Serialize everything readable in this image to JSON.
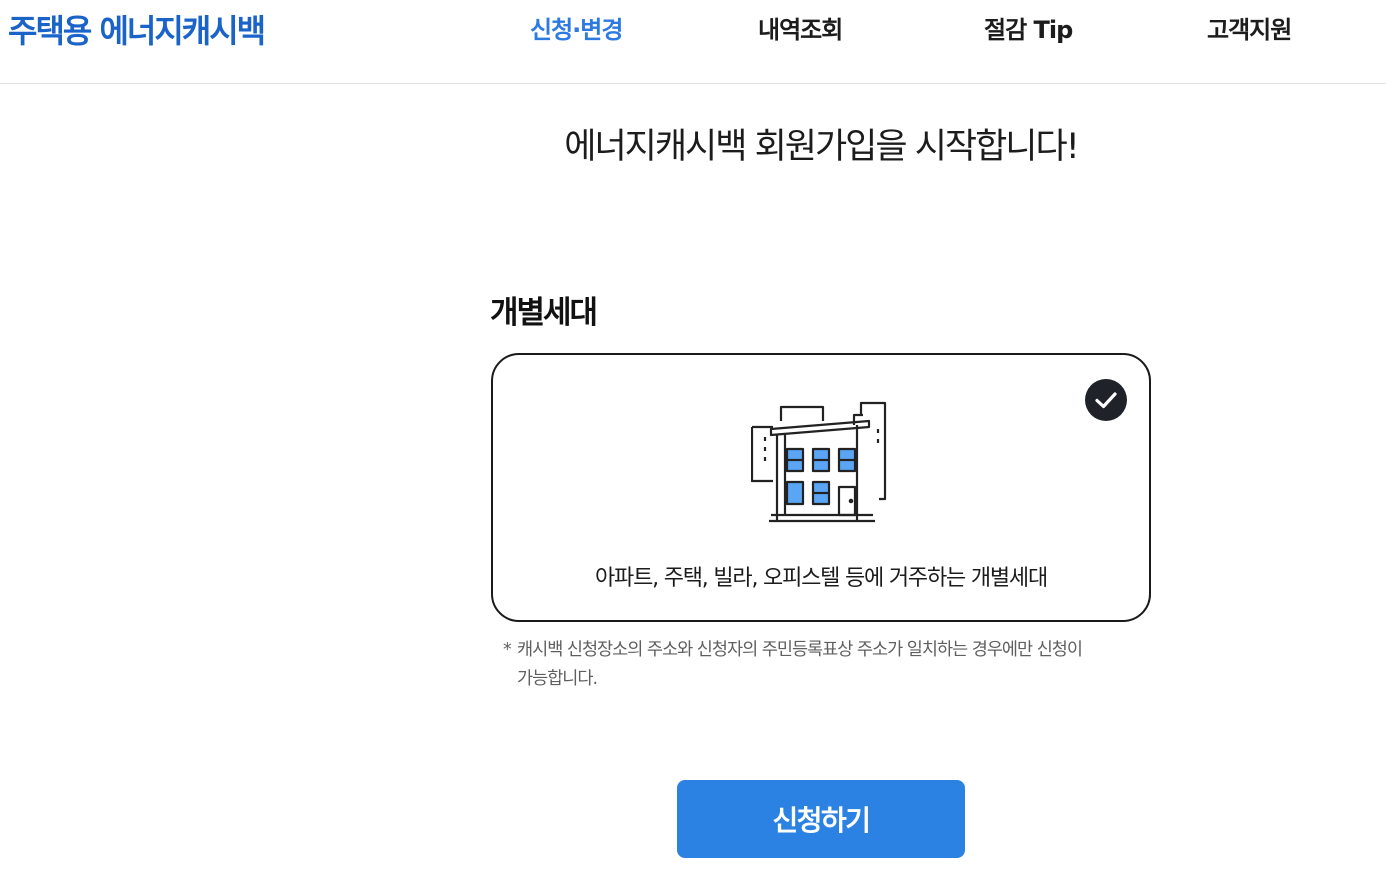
{
  "header": {
    "logo": "주택용 에너지캐시백",
    "nav": [
      {
        "label": "신청·변경",
        "active": true
      },
      {
        "label": "내역조회",
        "active": false
      },
      {
        "label": "절감 Tip",
        "active": false
      },
      {
        "label": "고객지원",
        "active": false
      }
    ]
  },
  "main": {
    "title": "에너지캐시백 회원가입을 시작합니다!",
    "section_title": "개별세대",
    "option": {
      "description": "아파트, 주택, 빌라, 오피스텔 등에 거주하는 개별세대",
      "selected": true,
      "icon": "building-icon"
    },
    "notice": {
      "marker": "*",
      "line1": "캐시백 신청장소의 주소와 신청자의 주민등록표상 주소가 일치하는 경우에만 신청이",
      "line2": "가능합니다."
    },
    "apply_button": "신청하기"
  },
  "colors": {
    "brand": "#1a63c9",
    "nav_active": "#2d7ae0",
    "button": "#2b82e3",
    "check": "#1f2329",
    "window": "#5aa6f5"
  }
}
